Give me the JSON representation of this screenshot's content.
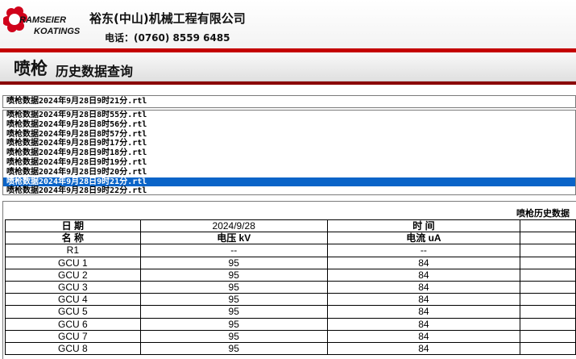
{
  "header": {
    "logo_line1": "RAMSEIER",
    "logo_line2": "KOATINGS",
    "company": "裕东(中山)机械工程有限公司",
    "phone": "电话：(0760) 8559 6485"
  },
  "page": {
    "title_main": "喷枪",
    "title_sub": "历史数据查询"
  },
  "file_select": {
    "current": "喷枪数据2024年9月28日9时21分.rtl",
    "options": [
      "喷枪数据2024年9月28日8时55分.rtl",
      "喷枪数据2024年9月28日8时56分.rtl",
      "喷枪数据2024年9月28日8时57分.rtl",
      "喷枪数据2024年9月28日9时17分.rtl",
      "喷枪数据2024年9月28日9时18分.rtl",
      "喷枪数据2024年9月28日9时19分.rtl",
      "喷枪数据2024年9月28日9时20分.rtl",
      "喷枪数据2024年9月28日9时21分.rtl",
      "喷枪数据2024年9月28日9时22分.rtl"
    ],
    "selected_index": 7
  },
  "report": {
    "title": "喷枪历史数据",
    "date_label": "日 期",
    "date_value": "2024/9/28",
    "time_label": "时 间",
    "time_value": "",
    "columns": [
      "名 称",
      "电压 kV",
      "电流 uA"
    ],
    "rows": [
      [
        "R1",
        "--",
        "--"
      ],
      [
        "GCU 1",
        "95",
        "84"
      ],
      [
        "GCU 2",
        "95",
        "84"
      ],
      [
        "GCU 3",
        "95",
        "84"
      ],
      [
        "GCU 4",
        "95",
        "84"
      ],
      [
        "GCU 5",
        "95",
        "84"
      ],
      [
        "GCU 6",
        "95",
        "84"
      ],
      [
        "GCU 7",
        "95",
        "84"
      ],
      [
        "GCU 8",
        "95",
        "84"
      ]
    ]
  },
  "colors": {
    "accent_red": "#c40000",
    "dark_red": "#8a0000",
    "selection_blue": "#0a64c8"
  }
}
